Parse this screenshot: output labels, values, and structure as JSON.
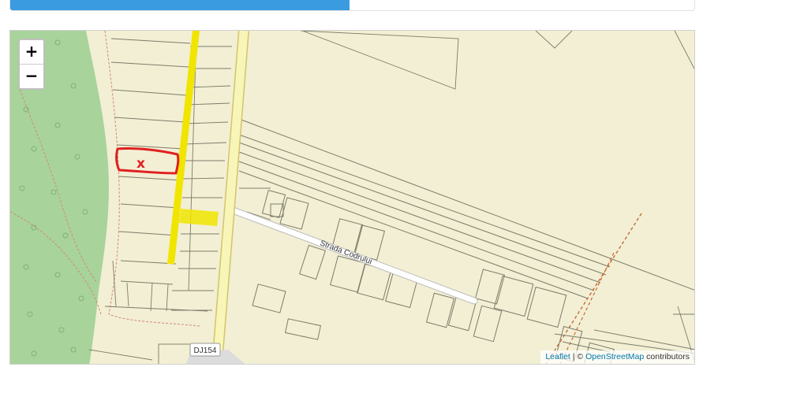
{
  "progress": {
    "fraction": 0.496,
    "color": "#3a9be0"
  },
  "map": {
    "zoom_in_label": "+",
    "zoom_out_label": "−",
    "street_name": "Strada Codrului",
    "road_ref": "DJ154",
    "marker_label": "x",
    "colors": {
      "land": "#f2efd4",
      "forest": "#a8d39a",
      "main_road": "#f7f6b8",
      "highlight": "#f0e500",
      "marker": "#e02020"
    }
  },
  "attribution": {
    "leaflet_link": "Leaflet",
    "separator": " | © ",
    "osm_link": "OpenStreetMap",
    "suffix": " contributors"
  }
}
